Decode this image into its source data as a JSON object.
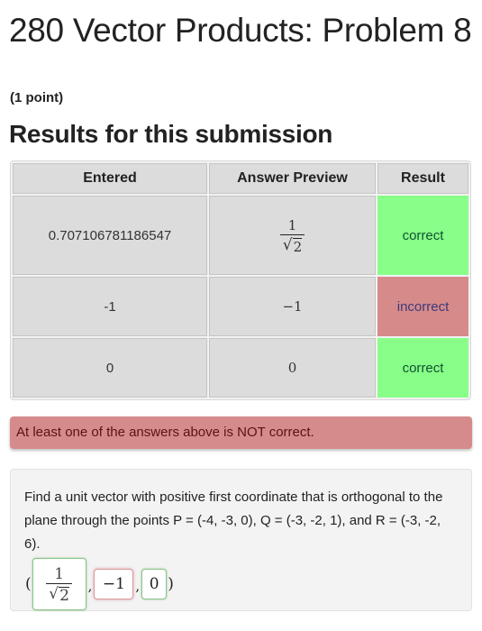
{
  "header": {
    "title": "280 Vector Products: Problem 8",
    "points": "(1 point)",
    "results_heading": "Results for this submission"
  },
  "results_table": {
    "columns": [
      "Entered",
      "Answer Preview",
      "Result"
    ],
    "rows": [
      {
        "entered": "0.707106781186547",
        "preview": {
          "type": "fraction",
          "numerator": "1",
          "denominator_sqrt": "2"
        },
        "result": "correct",
        "status": "correct"
      },
      {
        "entered": "-1",
        "preview": {
          "type": "text",
          "text": "−1"
        },
        "result": "incorrect",
        "status": "incorrect"
      },
      {
        "entered": "0",
        "preview": {
          "type": "text",
          "text": "0"
        },
        "result": "correct",
        "status": "correct"
      }
    ]
  },
  "alert": {
    "message": "At least one of the answers above is NOT correct."
  },
  "problem": {
    "text": "Find a unit vector with positive first coordinate that is orthogonal to the plane through the points P = (-4, -3, 0), Q = (-3, -2, 1), and R = (-3, -2, 6).",
    "answer": {
      "open": "(",
      "close": ")",
      "separator": ",",
      "fields": [
        {
          "numerator": "1",
          "radical": "√",
          "denominator_sqrt": "2",
          "status": "correct"
        },
        {
          "value": "−1",
          "status": "incorrect"
        },
        {
          "value": "0",
          "status": "correct"
        }
      ]
    }
  },
  "colors": {
    "correct": "#88ff88",
    "incorrect": "#d68a8a",
    "alert": "#d58b8b"
  }
}
